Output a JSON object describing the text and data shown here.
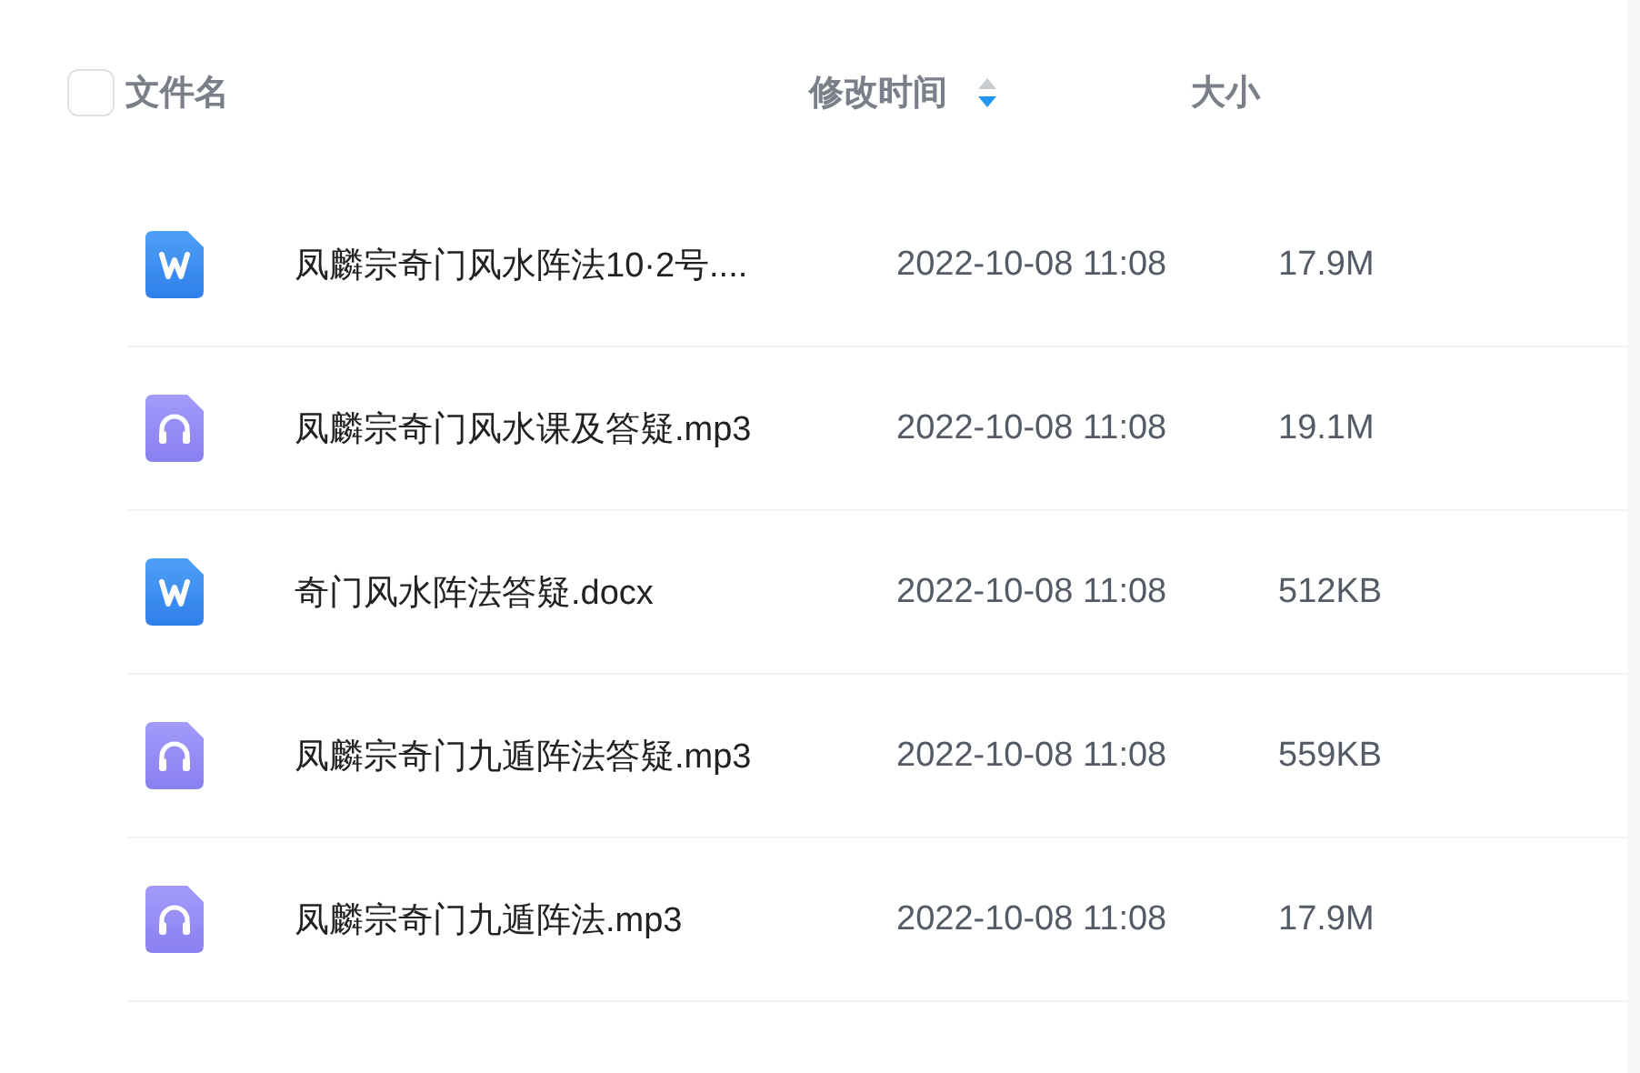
{
  "header": {
    "select_all": {
      "checked": false
    },
    "columns": [
      {
        "label": "文件名"
      },
      {
        "label": "修改时间",
        "sorted_descending": true
      },
      {
        "label": "大小"
      }
    ]
  },
  "files": [
    {
      "kind": "doc",
      "name": "凤麟宗奇门风水阵法10·2号....",
      "modified": "2022-10-08 11:08",
      "size": "17.9M"
    },
    {
      "kind": "audio",
      "name": "凤麟宗奇门风水课及答疑.mp3",
      "modified": "2022-10-08 11:08",
      "size": "19.1M"
    },
    {
      "kind": "doc",
      "name": "奇门风水阵法答疑.docx",
      "modified": "2022-10-08 11:08",
      "size": "512KB"
    },
    {
      "kind": "audio",
      "name": "凤麟宗奇门九遁阵法答疑.mp3",
      "modified": "2022-10-08 11:08",
      "size": "559KB"
    },
    {
      "kind": "audio",
      "name": "凤麟宗奇门九遁阵法.mp3",
      "modified": "2022-10-08 11:08",
      "size": "17.9M"
    }
  ]
}
